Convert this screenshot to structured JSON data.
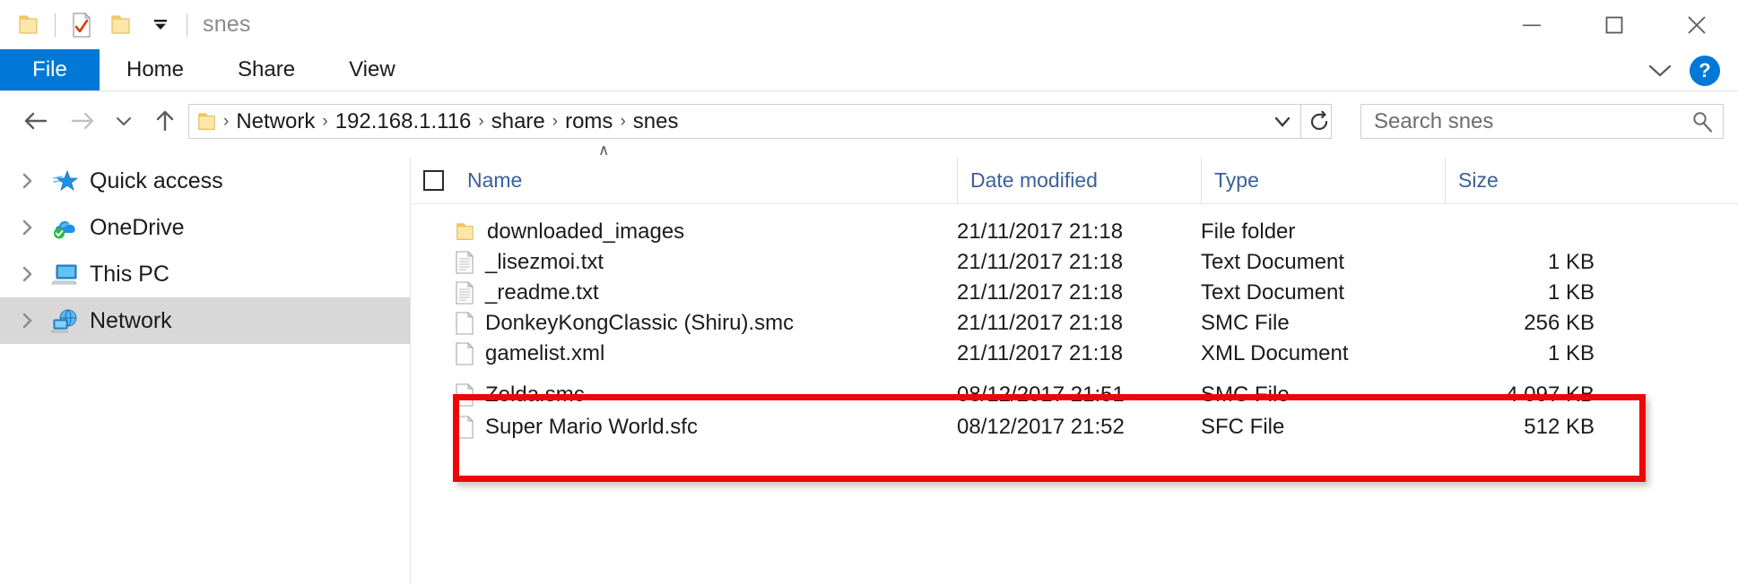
{
  "window": {
    "title": "snes",
    "quick_access_toolbar": [
      {
        "name": "folder-icon",
        "label": "Folder"
      },
      {
        "name": "properties-icon",
        "label": "Properties"
      },
      {
        "name": "new-folder-icon",
        "label": "New folder"
      },
      {
        "name": "customize-dropdown-icon",
        "label": "Customize Quick Access Toolbar"
      }
    ],
    "controls": {
      "minimize": "Minimize",
      "maximize": "Maximize",
      "close": "Close"
    }
  },
  "ribbon": {
    "tabs": [
      {
        "label": "File",
        "active": true
      },
      {
        "label": "Home",
        "active": false
      },
      {
        "label": "Share",
        "active": false
      },
      {
        "label": "View",
        "active": false
      }
    ],
    "expand_label": "Expand the Ribbon",
    "help_label": "?"
  },
  "address": {
    "back_label": "Back",
    "forward_label": "Forward",
    "recent_label": "Recent locations",
    "up_label": "Up",
    "breadcrumbs": [
      "Network",
      "192.168.1.116",
      "share",
      "roms",
      "snes"
    ],
    "separator": "›",
    "previous_locations_label": "Previous locations",
    "refresh_label": "Refresh"
  },
  "search": {
    "placeholder": "Search snes",
    "icon": "search-icon"
  },
  "sidebar": {
    "items": [
      {
        "label": "Quick access",
        "icon": "star-icon",
        "selected": false
      },
      {
        "label": "OneDrive",
        "icon": "cloud-icon",
        "selected": false
      },
      {
        "label": "This PC",
        "icon": "monitor-icon",
        "selected": false
      },
      {
        "label": "Network",
        "icon": "network-icon",
        "selected": true
      }
    ]
  },
  "file_list": {
    "columns": [
      {
        "label": "Name",
        "sort": "ascending"
      },
      {
        "label": "Date modified",
        "sort": ""
      },
      {
        "label": "Type",
        "sort": ""
      },
      {
        "label": "Size",
        "sort": ""
      }
    ],
    "sort_indicator": "∧",
    "rows": [
      {
        "name": "downloaded_images",
        "date": "21/11/2017 21:18",
        "type": "File folder",
        "size": "",
        "icon": "folder-icon",
        "highlighted": false
      },
      {
        "name": "_lisezmoi.txt",
        "date": "21/11/2017 21:18",
        "type": "Text Document",
        "size": "1 KB",
        "icon": "text-document-icon",
        "highlighted": false
      },
      {
        "name": "_readme.txt",
        "date": "21/11/2017 21:18",
        "type": "Text Document",
        "size": "1 KB",
        "icon": "text-document-icon",
        "highlighted": false
      },
      {
        "name": "DonkeyKongClassic (Shiru).smc",
        "date": "21/11/2017 21:18",
        "type": "SMC File",
        "size": "256 KB",
        "icon": "generic-file-icon",
        "highlighted": false
      },
      {
        "name": "gamelist.xml",
        "date": "21/11/2017 21:18",
        "type": "XML Document",
        "size": "1 KB",
        "icon": "generic-file-icon",
        "highlighted": false
      },
      {
        "name": "Zelda.smc",
        "date": "08/12/2017 21:51",
        "type": "SMC File",
        "size": "4 097 KB",
        "icon": "generic-file-icon",
        "highlighted": true
      },
      {
        "name": "Super Mario World.sfc",
        "date": "08/12/2017 21:52",
        "type": "SFC File",
        "size": "512 KB",
        "icon": "generic-file-icon",
        "highlighted": true
      }
    ]
  },
  "annotation": {
    "type": "rectangle-highlight",
    "color": "#ec0606",
    "covers": [
      "Zelda.smc",
      "Super Mario World.sfc"
    ]
  },
  "colors": {
    "accent": "#0078d7",
    "annotation": "#ec0606",
    "selection": "#d8d8d8",
    "header_text": "#3c6098"
  }
}
